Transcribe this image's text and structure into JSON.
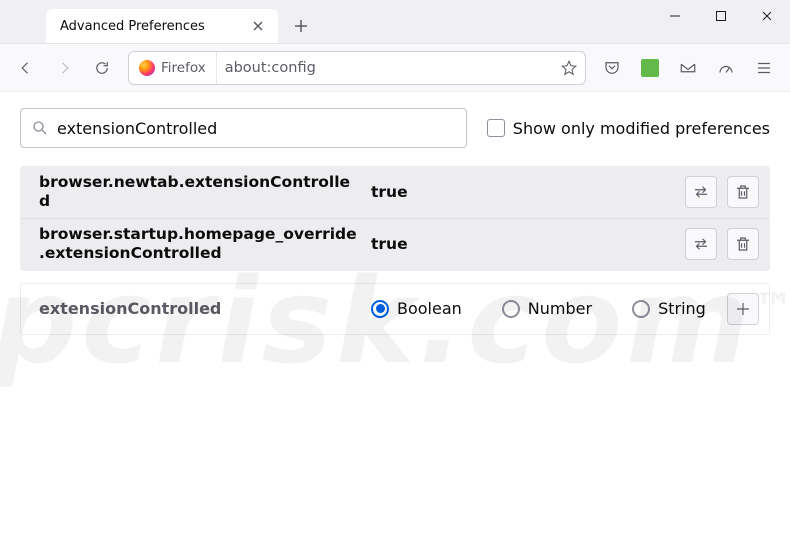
{
  "tab": {
    "title": "Advanced Preferences"
  },
  "urlbar": {
    "identity_label": "Firefox",
    "url": "about:config"
  },
  "search": {
    "value": "extensionControlled"
  },
  "show_only_modified_label": "Show only modified preferences",
  "prefs": [
    {
      "name": "browser.newtab.extensionControlled",
      "value": "true"
    },
    {
      "name": "browser.startup.homepage_override.extensionControlled",
      "value": "true"
    }
  ],
  "new_pref": {
    "name": "extensionControlled",
    "types": [
      "Boolean",
      "Number",
      "String"
    ],
    "selected": "Boolean"
  },
  "watermark": "pcrisk.com"
}
